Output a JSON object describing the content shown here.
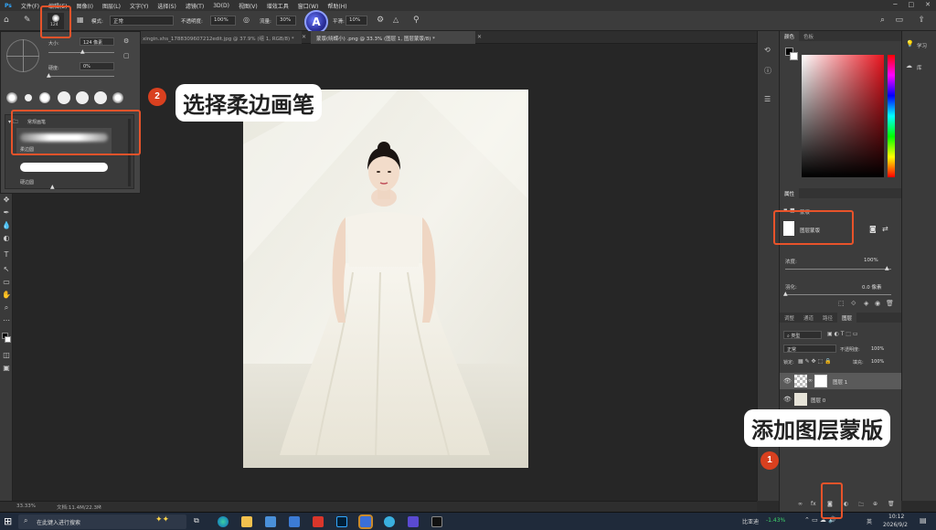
{
  "menubar": {
    "items": [
      "文件(F)",
      "编辑(E)",
      "图像(I)",
      "图层(L)",
      "文字(Y)",
      "选择(S)",
      "滤镜(T)",
      "3D(D)",
      "视图(V)",
      "增效工具",
      "窗口(W)",
      "帮助(H)"
    ]
  },
  "optbar": {
    "brush_size": "124",
    "mode_label": "模式:",
    "mode_value": "正常",
    "opacity_label": "不透明度:",
    "opacity_value": "100%",
    "flow_label": "流量:",
    "flow_value": "30%",
    "smooth_label": "平滑:",
    "smooth_value": "10%"
  },
  "tabs": [
    {
      "label": "xingin.xhs_1788309607212edit.jpg @ 37.9% (组 1, RGB/8) *"
    },
    {
      "label": "蒙版(晓蝶小) .png @ 33.3% (图层 1, 图层蒙版/8) *"
    }
  ],
  "brush_picker": {
    "size_label": "大小:",
    "size_value": "124 像素",
    "hardness_label": "硬度:",
    "hardness_value": "0%",
    "folder_label": "常规画笔",
    "brush_items": [
      "柔边圆",
      "硬边圆"
    ]
  },
  "color_panel": {
    "tabs": [
      "颜色",
      "色板"
    ]
  },
  "properties_panel": {
    "title": "属性",
    "section": "蒙版",
    "mask_label": "图层蒙版",
    "density_label": "浓度:",
    "density_value": "100%",
    "feather_label": "羽化:",
    "feather_value": "0.0 像素"
  },
  "layers_panel": {
    "tabs": [
      "调整",
      "通道",
      "路径",
      "图层"
    ],
    "filter_label": "类型",
    "blend_mode": "正常",
    "opacity_label": "不透明度:",
    "opacity_value": "100%",
    "lock_label": "锁定:",
    "fill_label": "填充:",
    "fill_value": "100%",
    "layers": [
      {
        "name": "图层 1"
      },
      {
        "name": "图层 0"
      }
    ]
  },
  "learn_panel": {
    "items": [
      "学习",
      "库"
    ]
  },
  "statusbar": {
    "zoom": "33.33%",
    "doc": "文档:11.4M/22.3M"
  },
  "taskbar": {
    "search_placeholder": "在此键入进行搜索",
    "stock_name": "比亚迪",
    "stock_change": "-1.43%",
    "lang": "英",
    "time": "10:12",
    "date": "2026/9/2"
  },
  "annotations": {
    "step2_number": "2",
    "step2_text": "选择柔边画笔",
    "step1_number": "1",
    "step1_text": "添加图层蒙版"
  },
  "colors": {
    "accent_red": "#e8532a",
    "badge_red": "#d9401f"
  }
}
